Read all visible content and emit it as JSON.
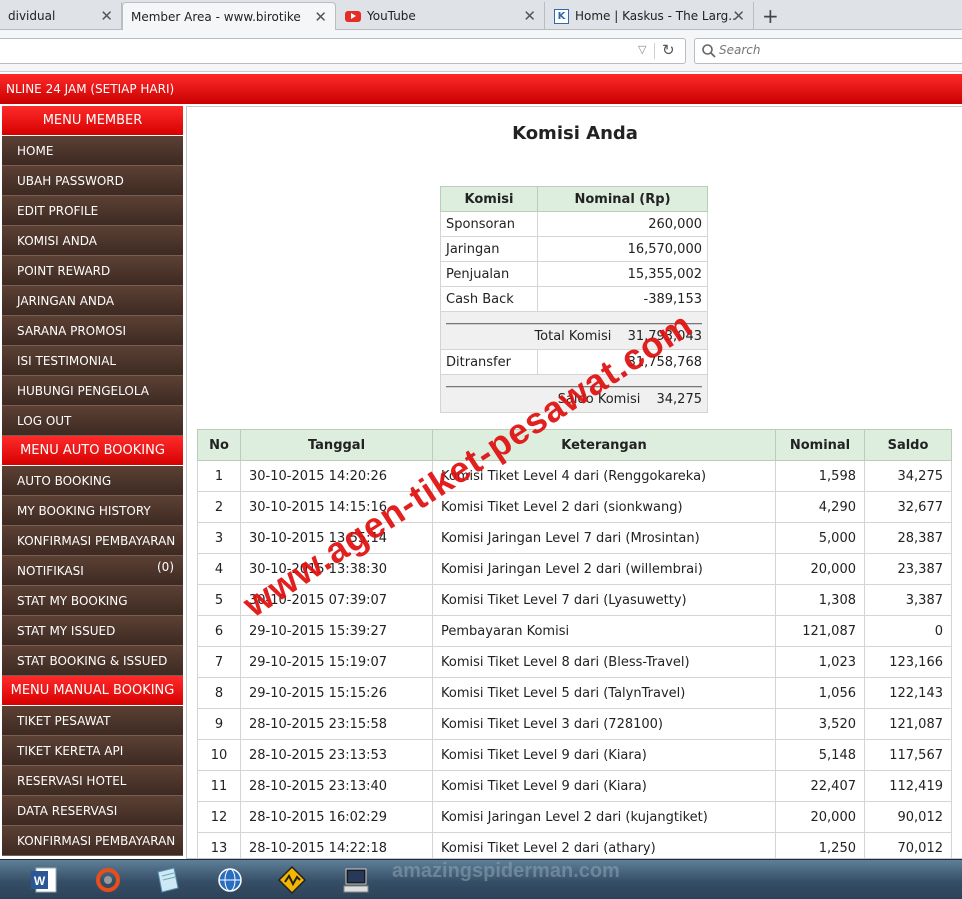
{
  "browser": {
    "tabs": [
      {
        "label": "dividual",
        "active": false
      },
      {
        "label": "Member Area - www.birotiket....",
        "active": true
      },
      {
        "label": "YouTube",
        "active": false,
        "icon": "youtube-icon"
      },
      {
        "label": "Home | Kaskus - The Larg...",
        "active": false,
        "icon": "kaskus-icon"
      }
    ],
    "new_tab": "+",
    "close": "✕",
    "search_placeholder": "Search",
    "dropdown_glyph": "▽",
    "reload_glyph": "↻"
  },
  "banner": {
    "text": "NLINE 24 JAM (SETIAP HARI)"
  },
  "sidebar": {
    "sections": [
      {
        "title": "MENU MEMBER",
        "items": [
          {
            "label": "HOME"
          },
          {
            "label": "UBAH PASSWORD"
          },
          {
            "label": "EDIT PROFILE"
          },
          {
            "label": "KOMISI ANDA"
          },
          {
            "label": "POINT REWARD"
          },
          {
            "label": "JARINGAN ANDA"
          },
          {
            "label": "SARANA PROMOSI"
          },
          {
            "label": "ISI TESTIMONIAL"
          },
          {
            "label": "HUBUNGI PENGELOLA"
          },
          {
            "label": "LOG OUT"
          }
        ]
      },
      {
        "title": "MENU AUTO BOOKING",
        "items": [
          {
            "label": "AUTO BOOKING"
          },
          {
            "label": "MY BOOKING HISTORY"
          },
          {
            "label": "KONFIRMASI PEMBAYARAN"
          },
          {
            "label": "NOTIFIKASI",
            "badge": "(0)"
          },
          {
            "label": "STAT MY BOOKING"
          },
          {
            "label": "STAT MY ISSUED"
          },
          {
            "label": "STAT BOOKING & ISSUED"
          }
        ]
      },
      {
        "title": "MENU MANUAL BOOKING",
        "items": [
          {
            "label": "TIKET PESAWAT"
          },
          {
            "label": "TIKET KERETA API"
          },
          {
            "label": "RESERVASI HOTEL"
          },
          {
            "label": "DATA RESERVASI"
          },
          {
            "label": "KONFIRMASI PEMBAYARAN"
          }
        ]
      }
    ]
  },
  "main": {
    "title": "Komisi Anda",
    "summary": {
      "headers": [
        "Komisi",
        "Nominal (Rp)"
      ],
      "rows": [
        {
          "label": "Sponsoran",
          "value": "260,000"
        },
        {
          "label": "Jaringan",
          "value": "16,570,000"
        },
        {
          "label": "Penjualan",
          "value": "15,355,002"
        },
        {
          "label": "Cash Back",
          "value": "-389,153"
        }
      ],
      "total_label": "Total Komisi",
      "total_value": "31,793,043",
      "transfer_label": "Ditransfer",
      "transfer_value": "31,758,768",
      "saldo_label": "Saldo Komisi",
      "saldo_value": "34,275"
    },
    "history": {
      "headers": [
        "No",
        "Tanggal",
        "Keterangan",
        "Nominal",
        "Saldo"
      ],
      "rows": [
        [
          "1",
          "30-10-2015 14:20:26",
          "Komisi Tiket Level 4 dari (Renggokareka)",
          "1,598",
          "34,275"
        ],
        [
          "2",
          "30-10-2015 14:15:16",
          "Komisi Tiket Level 2 dari (sionkwang)",
          "4,290",
          "32,677"
        ],
        [
          "3",
          "30-10-2015 13:55:14",
          "Komisi Jaringan Level 7 dari (Mrosintan)",
          "5,000",
          "28,387"
        ],
        [
          "4",
          "30-10-2015 13:38:30",
          "Komisi Jaringan Level 2 dari (willembrai)",
          "20,000",
          "23,387"
        ],
        [
          "5",
          "30-10-2015 07:39:07",
          "Komisi Tiket Level 7 dari (Lyasuwetty)",
          "1,308",
          "3,387"
        ],
        [
          "6",
          "29-10-2015 15:39:27",
          "Pembayaran Komisi",
          "121,087",
          "0"
        ],
        [
          "7",
          "29-10-2015 15:19:07",
          "Komisi Tiket Level 8 dari (Bless-Travel)",
          "1,023",
          "123,166"
        ],
        [
          "8",
          "29-10-2015 15:15:26",
          "Komisi Tiket Level 5 dari (TalynTravel)",
          "1,056",
          "122,143"
        ],
        [
          "9",
          "28-10-2015 23:15:58",
          "Komisi Tiket Level 3 dari (728100)",
          "3,520",
          "121,087"
        ],
        [
          "10",
          "28-10-2015 23:13:53",
          "Komisi Tiket Level 9 dari (Kiara)",
          "5,148",
          "117,567"
        ],
        [
          "11",
          "28-10-2015 23:13:40",
          "Komisi Tiket Level 9 dari (Kiara)",
          "22,407",
          "112,419"
        ],
        [
          "12",
          "28-10-2015 16:02:29",
          "Komisi Jaringan Level 2 dari (kujangtiket)",
          "20,000",
          "90,012"
        ],
        [
          "13",
          "28-10-2015 14:22:18",
          "Komisi Tiket Level 2 dari (athary)",
          "1,250",
          "70,012"
        ]
      ]
    }
  },
  "watermark": "www.agen-tiket-pesawat.com",
  "taskbar": {
    "background_text": "amazingspiderman.com",
    "icons": [
      "word-icon",
      "app-icon",
      "notepad-icon",
      "globe-icon",
      "winamp-icon",
      "computer-icon"
    ]
  },
  "colors": {
    "accent_red": "#e00000",
    "sidebar_brown": "#4a332a",
    "table_header": "#ddeede"
  }
}
